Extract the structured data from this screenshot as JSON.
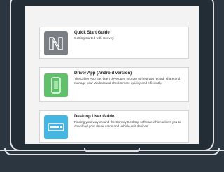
{
  "guides": [
    {
      "title": "Quick Start Guide",
      "description": "Getting started with Convey.",
      "icon": "convey-logo-icon",
      "color": "#7a7f85"
    },
    {
      "title": "Driver App (Android version)",
      "description": "The Driver App has been developed in order to help you record, share and manage your Walkaround checks more quickly and efficiently.",
      "icon": "phone-checklist-icon",
      "color": "#5fc169"
    },
    {
      "title": "Desktop User Guide",
      "description": "Finding your way around the Convey Desktop software which allows you to download your driver cards and vehicle unit devices.",
      "icon": "card-reader-icon",
      "color": "#43b6e3"
    }
  ]
}
